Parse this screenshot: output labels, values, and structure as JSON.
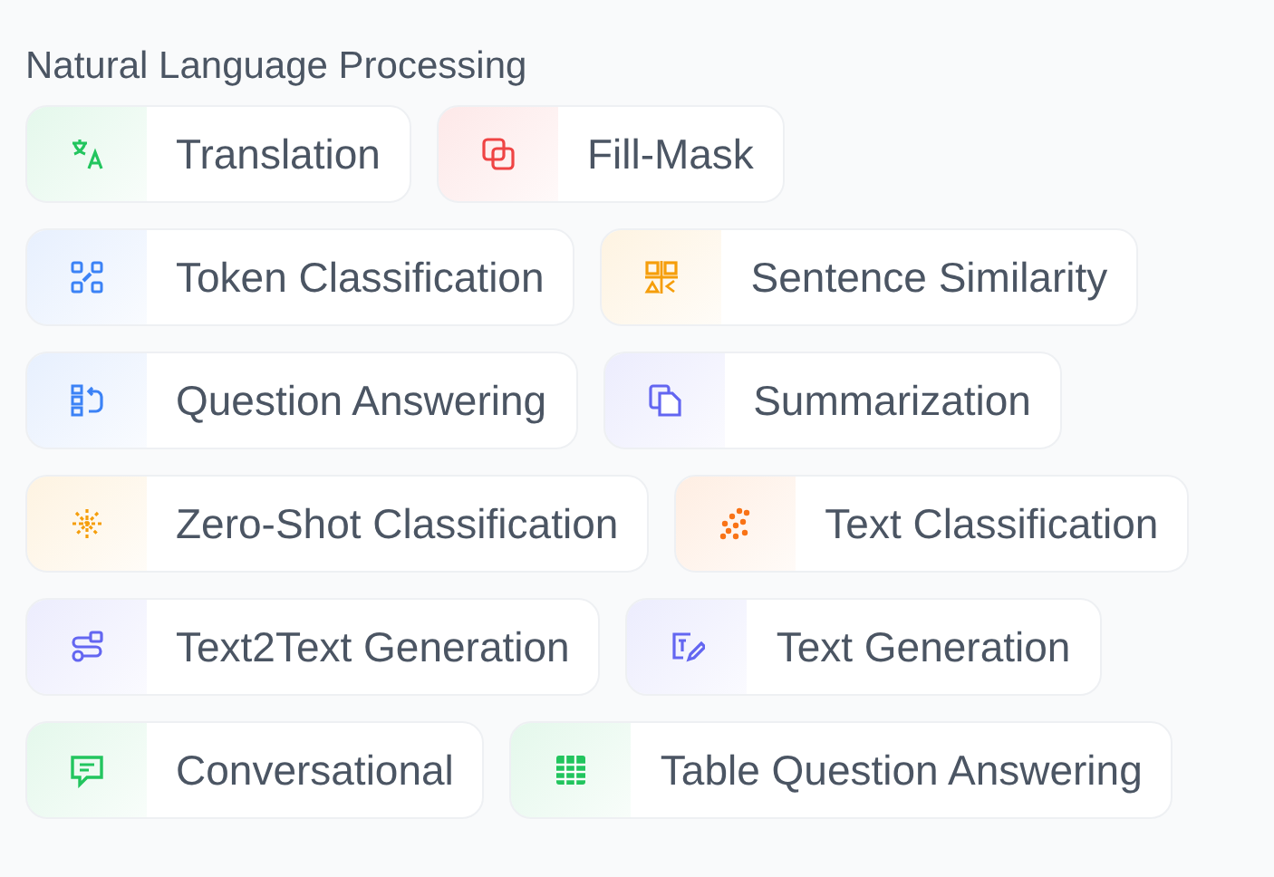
{
  "section": {
    "title": "Natural Language Processing",
    "rows": [
      [
        {
          "label": "Translation",
          "kind": "translate",
          "color": "#22c55e"
        },
        {
          "label": "Fill-Mask",
          "kind": "mask",
          "color": "#ef4444"
        }
      ],
      [
        {
          "label": "Token Classification",
          "kind": "tokens",
          "color": "#3b82f6"
        },
        {
          "label": "Sentence Similarity",
          "kind": "similarity",
          "color": "#f59e0b"
        }
      ],
      [
        {
          "label": "Question Answering",
          "kind": "qa",
          "color": "#3b82f6"
        },
        {
          "label": "Summarization",
          "kind": "summary",
          "color": "#6366f1"
        }
      ],
      [
        {
          "label": "Zero-Shot Classification",
          "kind": "zeroshot",
          "color": "#f59e0b"
        },
        {
          "label": "Text Classification",
          "kind": "textclass",
          "color": "#f97316"
        }
      ],
      [
        {
          "label": "Text2Text Generation",
          "kind": "t2t",
          "color": "#6366f1"
        },
        {
          "label": "Text Generation",
          "kind": "textgen",
          "color": "#6366f1"
        }
      ],
      [
        {
          "label": "Conversational",
          "kind": "chat",
          "color": "#22c55e"
        },
        {
          "label": "Table Question Answering",
          "kind": "table",
          "color": "#22c55e"
        }
      ]
    ]
  }
}
